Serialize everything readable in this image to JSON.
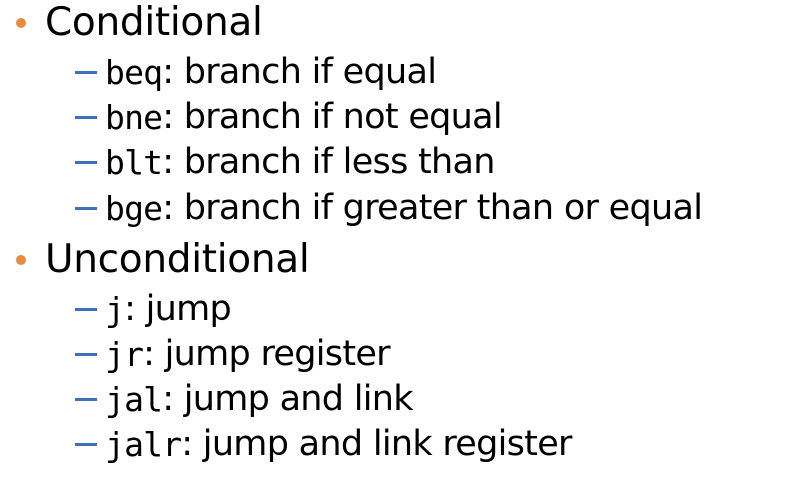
{
  "colors": {
    "bullet": "#e98a3e",
    "dash": "#3f6fb5",
    "text": "#000000"
  },
  "sections": [
    {
      "label": "Conditional",
      "items": [
        {
          "mnemonic": "beq",
          "description": ": branch if equal"
        },
        {
          "mnemonic": "bne",
          "description": ": branch if not equal"
        },
        {
          "mnemonic": "blt",
          "description": ": branch if less than"
        },
        {
          "mnemonic": "bge",
          "description": ": branch if greater than or equal"
        }
      ]
    },
    {
      "label": "Unconditional",
      "items": [
        {
          "mnemonic": "j",
          "description": ": jump"
        },
        {
          "mnemonic": "jr",
          "description": ": jump register"
        },
        {
          "mnemonic": "jal",
          "description": ": jump and link"
        },
        {
          "mnemonic": "jalr",
          "description": ": jump and link register"
        }
      ]
    }
  ]
}
